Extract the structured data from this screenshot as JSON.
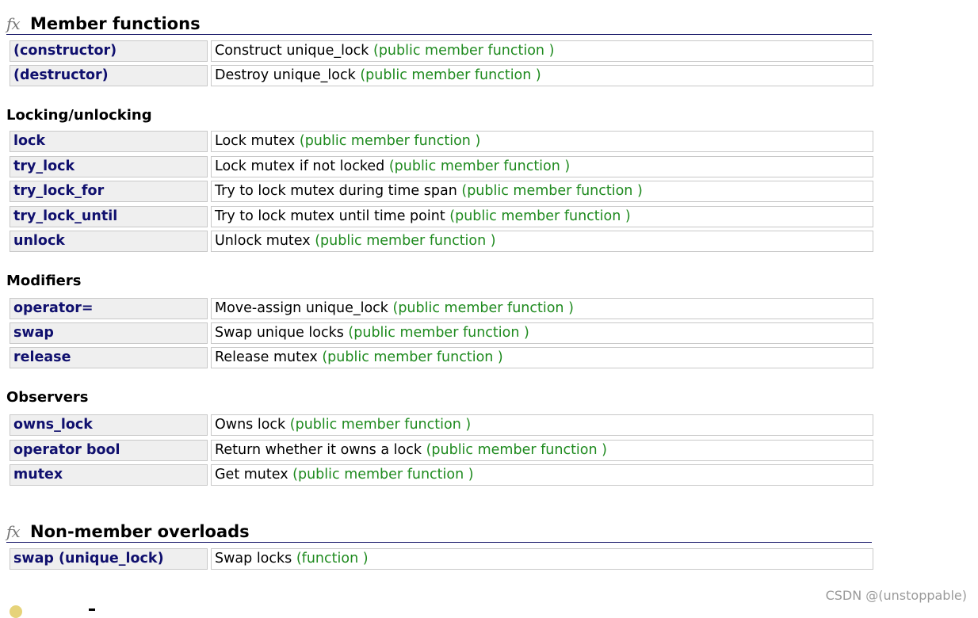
{
  "member_functions": {
    "icon": "fx",
    "title": "Member functions",
    "rows": [
      {
        "name": "(constructor)",
        "desc": "Construct unique_lock",
        "kind": "(public member function )"
      },
      {
        "name": "(destructor)",
        "desc": "Destroy unique_lock",
        "kind": "(public member function )"
      }
    ]
  },
  "locking": {
    "title": "Locking/unlocking",
    "rows": [
      {
        "name": "lock",
        "desc": "Lock mutex",
        "kind": "(public member function )"
      },
      {
        "name": "try_lock",
        "desc": "Lock mutex if not locked",
        "kind": "(public member function )"
      },
      {
        "name": "try_lock_for",
        "desc": "Try to lock mutex during time span",
        "kind": "(public member function )"
      },
      {
        "name": "try_lock_until",
        "desc": "Try to lock mutex until time point",
        "kind": "(public member function )"
      },
      {
        "name": "unlock",
        "desc": "Unlock mutex",
        "kind": "(public member function )"
      }
    ]
  },
  "modifiers": {
    "title": "Modifiers",
    "rows": [
      {
        "name": "operator=",
        "desc": "Move-assign unique_lock",
        "kind": "(public member function )"
      },
      {
        "name": "swap",
        "desc": "Swap unique locks",
        "kind": "(public member function )"
      },
      {
        "name": "release",
        "desc": "Release mutex",
        "kind": "(public member function )"
      }
    ]
  },
  "observers": {
    "title": "Observers",
    "rows": [
      {
        "name": "owns_lock",
        "desc": "Owns lock",
        "kind": "(public member function )"
      },
      {
        "name": "operator bool",
        "desc": "Return whether it owns a lock",
        "kind": "(public member function )"
      },
      {
        "name": "mutex",
        "desc": "Get mutex",
        "kind": "(public member function )"
      }
    ]
  },
  "non_member": {
    "icon": "fx",
    "title": "Non-member overloads",
    "rows": [
      {
        "name": "swap (unique_lock)",
        "desc": "Swap locks",
        "kind": "(function )"
      }
    ]
  },
  "watermark": "CSDN @(unstoppable)",
  "colors": {
    "link_name": "#10106e",
    "kind_green": "#1e8a1e",
    "name_cell_bg": "#efefef",
    "border": "#c8c8c8",
    "header_rule": "#1c1c6c"
  }
}
